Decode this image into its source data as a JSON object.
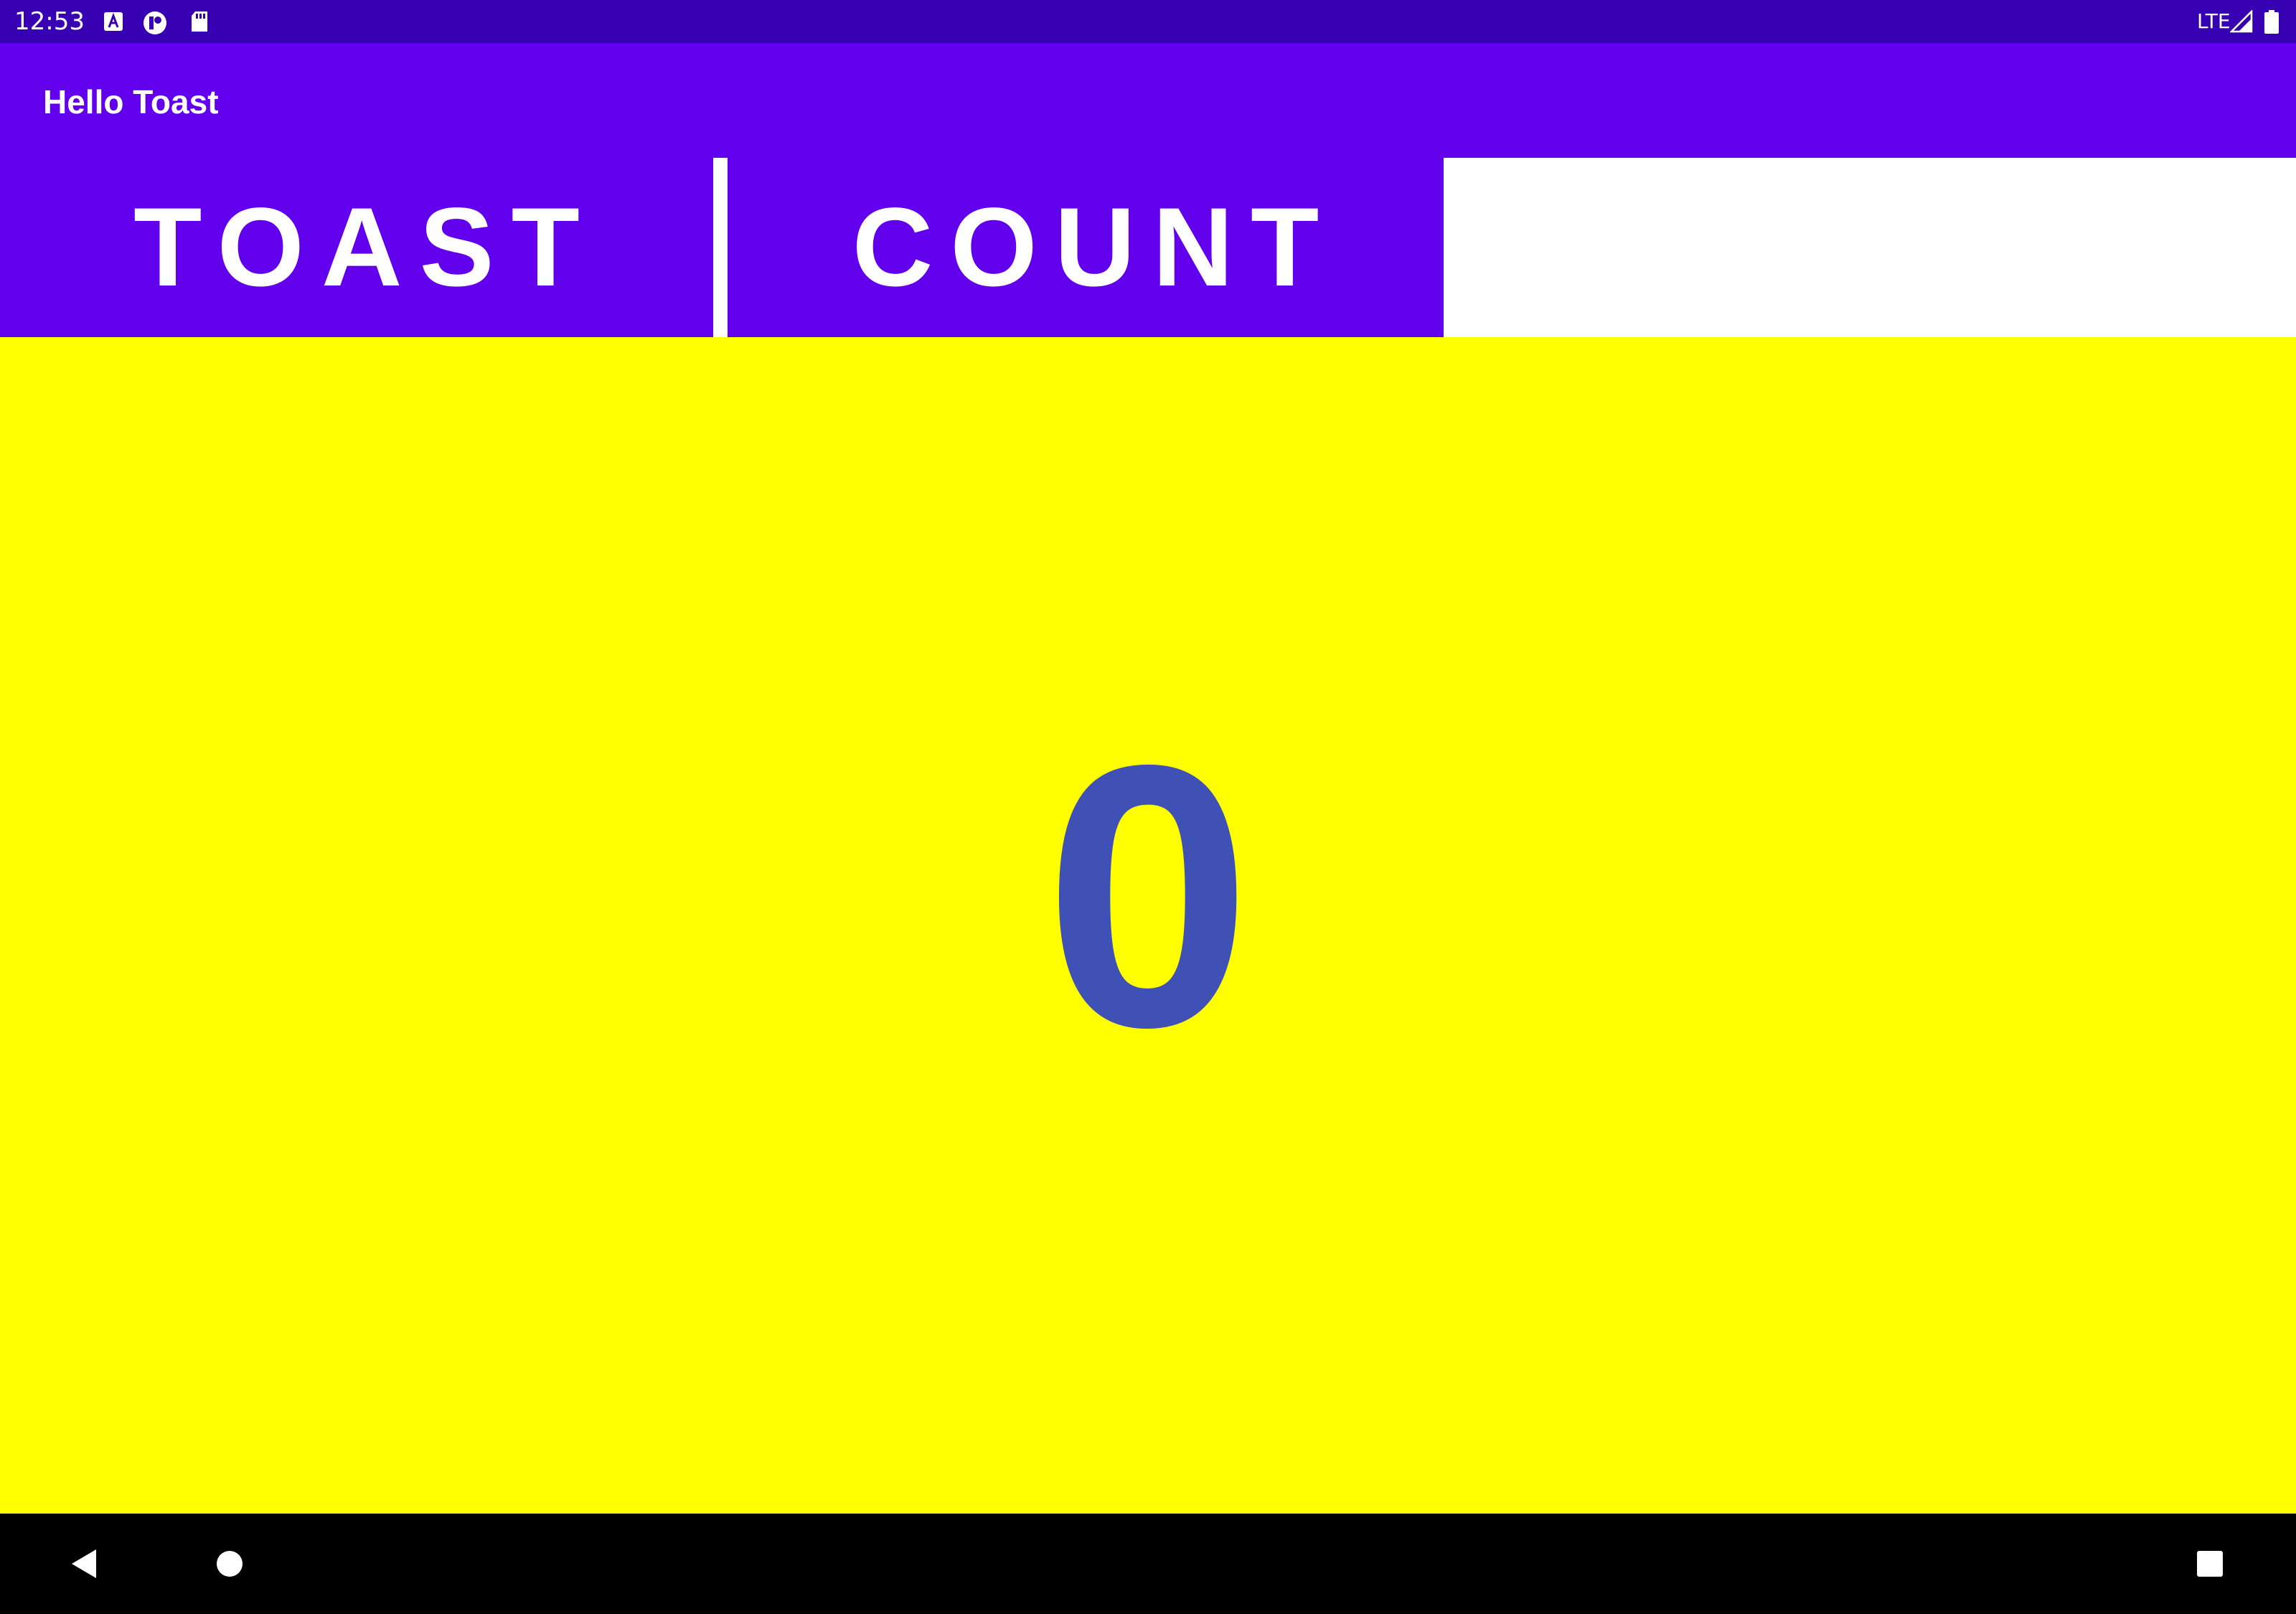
{
  "status_bar": {
    "time": "12:53",
    "network": "LTE",
    "icons": [
      "a-badge-icon",
      "record-icon",
      "sd-card-icon",
      "signal-icon",
      "battery-icon"
    ]
  },
  "app_bar": {
    "title": "Hello Toast"
  },
  "buttons": {
    "toast_label": "TOAST",
    "count_label": "COUNT"
  },
  "counter": {
    "value": "0"
  },
  "nav_bar": {
    "icons": [
      "back-icon",
      "home-icon",
      "recents-icon"
    ]
  },
  "colors": {
    "status_bar": "#3700b3",
    "primary": "#6200ee",
    "count_background": "#ffff00",
    "count_text": "#3f51b5"
  }
}
